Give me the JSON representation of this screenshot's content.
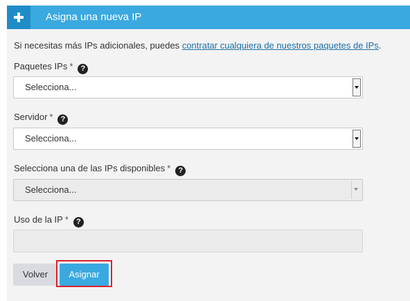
{
  "header": {
    "title": "Asigna una nueva IP",
    "icon": "plus-icon"
  },
  "intro": {
    "text": "Si necesitas más IPs adicionales, puedes ",
    "link_text": "contratar cualquiera de nuestros paquetes de IPs",
    "suffix": "."
  },
  "fields": {
    "paquetes": {
      "label": "Paquetes IPs",
      "required_mark": "*",
      "help_icon": "?",
      "selected": "Selecciona..."
    },
    "servidor": {
      "label": "Servidor",
      "required_mark": "*",
      "help_icon": "?",
      "selected": "Selecciona..."
    },
    "ip_disponible": {
      "label": "Selecciona una de las IPs disponibles",
      "required_mark": "*",
      "help_icon": "?",
      "selected": "Selecciona...",
      "disabled": true
    },
    "uso_ip": {
      "label": "Uso de la IP",
      "required_mark": "*",
      "help_icon": "?",
      "value": "",
      "disabled": true
    }
  },
  "buttons": {
    "back_label": "Volver",
    "assign_label": "Asignar"
  },
  "colors": {
    "header_bg": "#3aa9e0",
    "header_icon_bg": "#1f8cc8",
    "assign_button": "#3aa9e0",
    "back_button": "#d9dbe0",
    "highlight": "#d9232a",
    "link": "#1a6fa8"
  }
}
